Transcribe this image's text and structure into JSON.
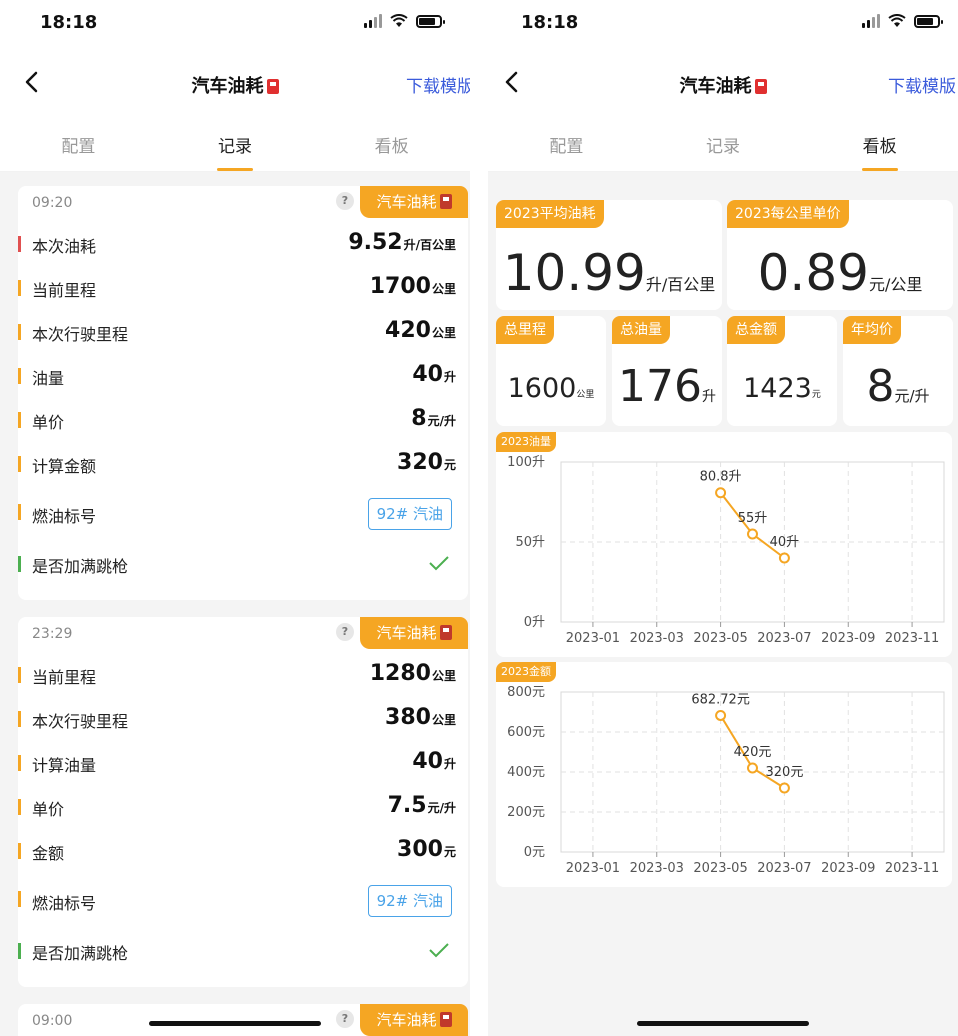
{
  "status": {
    "time": "18:18"
  },
  "nav": {
    "title": "汽车油耗",
    "action": "下载模版"
  },
  "tabs": [
    "配置",
    "记录",
    "看板"
  ],
  "left": {
    "records": [
      {
        "time": "09:20",
        "tag": "汽车油耗",
        "help": "?",
        "rows": [
          {
            "label": "本次油耗",
            "value": "9.52",
            "unit": "升/百公里",
            "bar": "#e05050"
          },
          {
            "label": "当前里程",
            "value": "1700",
            "unit": "公里"
          },
          {
            "label": "本次行驶里程",
            "value": "420",
            "unit": "公里"
          },
          {
            "label": "油量",
            "value": "40",
            "unit": "升"
          },
          {
            "label": "单价",
            "value": "8",
            "unit": "元/升"
          },
          {
            "label": "计算金额",
            "value": "320",
            "unit": "元"
          }
        ],
        "fuel_label": "燃油标号",
        "fuel_value": "92# 汽油",
        "full_label": "是否加满跳枪"
      },
      {
        "time": "23:29",
        "tag": "汽车油耗",
        "help": "?",
        "rows": [
          {
            "label": "当前里程",
            "value": "1280",
            "unit": "公里"
          },
          {
            "label": "本次行驶里程",
            "value": "380",
            "unit": "公里"
          },
          {
            "label": "计算油量",
            "value": "40",
            "unit": "升"
          },
          {
            "label": "单价",
            "value": "7.5",
            "unit": "元/升"
          },
          {
            "label": "金额",
            "value": "300",
            "unit": "元"
          }
        ],
        "fuel_label": "燃油标号",
        "fuel_value": "92# 汽油",
        "full_label": "是否加满跳枪"
      }
    ],
    "partial_record": {
      "time": "09:00",
      "tag": "汽车油耗",
      "help": "?"
    }
  },
  "dashboard": {
    "avg_consumption": {
      "label": "2023平均油耗",
      "value": "10.99",
      "unit": "升/百公里"
    },
    "unit_cost": {
      "label": "2023每公里单价",
      "value": "0.89",
      "unit": "元/公里"
    },
    "total_mileage": {
      "label": "总里程",
      "value": "1600",
      "unit": "公里"
    },
    "total_fuel": {
      "label": "总油量",
      "value": "176",
      "unit": "升"
    },
    "total_amount": {
      "label": "总金额",
      "value": "1423",
      "unit": "元"
    },
    "avg_price": {
      "label": "年均价",
      "value": "8",
      "unit": "元/升"
    }
  },
  "colors": {
    "accent": "#f5a623",
    "link": "#3b5bdb",
    "fuel_tag": "#4aa3e8",
    "check": "#4caf50",
    "red_bar": "#e05050"
  },
  "chart_data": [
    {
      "type": "line",
      "title": "2023油量",
      "x_ticks": [
        "2023-01",
        "2023-03",
        "2023-05",
        "2023-07",
        "2023-09",
        "2023-11"
      ],
      "y_ticks": [
        "0升",
        "50升",
        "100升"
      ],
      "ylim": [
        0,
        100
      ],
      "xlim": [
        "2022-12",
        "2023-12"
      ],
      "points": [
        {
          "x": "2023-05",
          "y": 80.8,
          "label": "80.8升"
        },
        {
          "x": "2023-06",
          "y": 55,
          "label": "55升"
        },
        {
          "x": "2023-07",
          "y": 40,
          "label": "40升"
        }
      ],
      "grid": true
    },
    {
      "type": "line",
      "title": "2023金额",
      "x_ticks": [
        "2023-01",
        "2023-03",
        "2023-05",
        "2023-07",
        "2023-09",
        "2023-11"
      ],
      "y_ticks": [
        "0元",
        "200元",
        "400元",
        "600元",
        "800元"
      ],
      "ylim": [
        0,
        800
      ],
      "xlim": [
        "2022-12",
        "2023-12"
      ],
      "points": [
        {
          "x": "2023-05",
          "y": 682.72,
          "label": "682.72元"
        },
        {
          "x": "2023-06",
          "y": 420,
          "label": "420元"
        },
        {
          "x": "2023-07",
          "y": 320,
          "label": "320元"
        }
      ],
      "grid": true
    }
  ]
}
